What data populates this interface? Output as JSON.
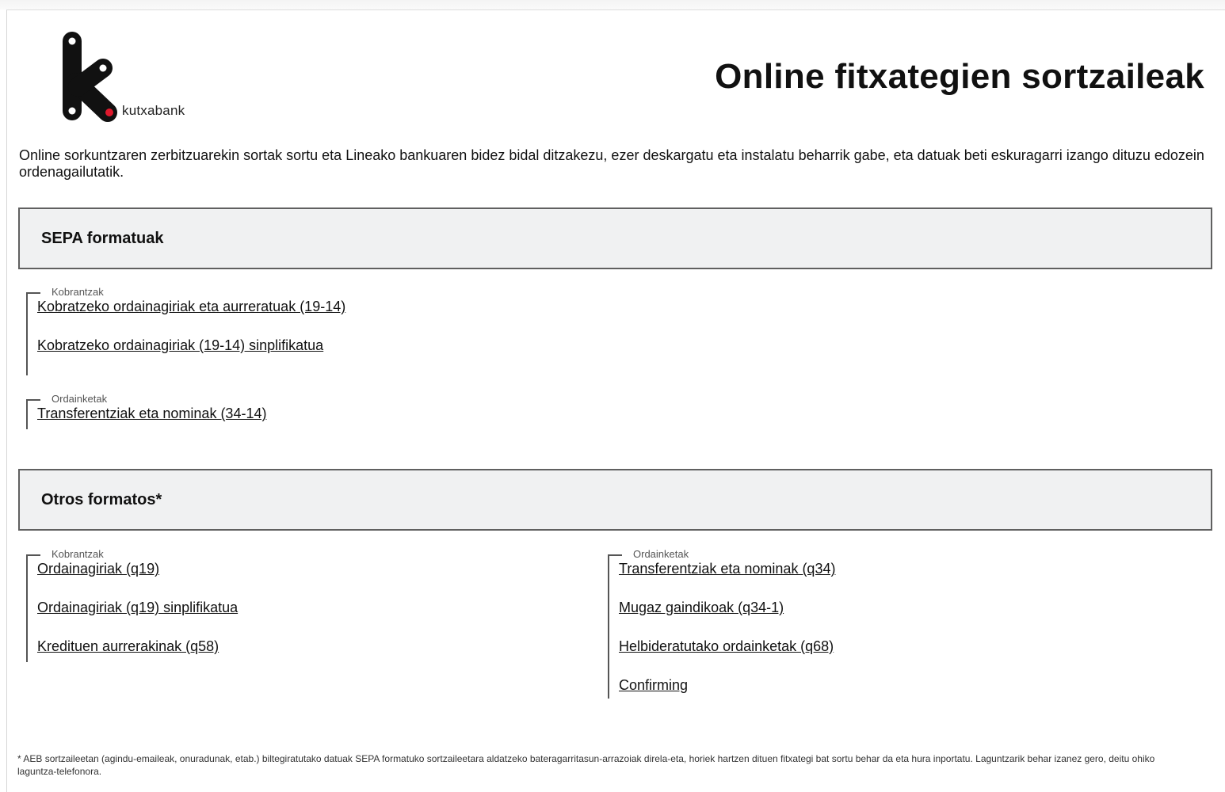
{
  "header": {
    "logo_text": "kutxabank",
    "title": "Online fitxategien sortzaileak"
  },
  "intro": "Online sorkuntzaren zerbitzuarekin sortak sortu eta Lineako bankuaren bidez bidal ditzakezu, ezer deskargatu eta instalatu beharrik gabe, eta datuak beti eskuragarri izango dituzu edozein ordenagailutatik.",
  "sections": {
    "sepa": {
      "title": "SEPA formatuak",
      "kobrantzak": {
        "legend": "Kobrantzak",
        "links": [
          "Kobratzeko ordainagiriak eta aurreratuak (19-14)",
          "Kobratzeko ordainagiriak (19-14) sinplifikatua"
        ]
      },
      "ordainketak": {
        "legend": "Ordainketak",
        "links": [
          "Transferentziak eta nominak (34-14)"
        ]
      }
    },
    "otros": {
      "title": "Otros formatos*",
      "kobrantzak": {
        "legend": "Kobrantzak",
        "links": [
          "Ordainagiriak (q19)",
          "Ordainagiriak (q19) sinplifikatua",
          "Kredituen aurrerakinak (q58)"
        ]
      },
      "ordainketak": {
        "legend": "Ordainketak",
        "links": [
          "Transferentziak eta nominak (q34)",
          "Mugaz gaindikoak (q34-1)",
          "Helbideratutako ordainketak (q68)",
          "Confirming"
        ]
      }
    }
  },
  "footnote": "* AEB sortzaileetan (agindu-emaileak, onuradunak, etab.) biltegiratutako datuak SEPA formatuko sortzaileetara aldatzeko bateragarritasun-arrazoiak direla-eta, horiek hartzen dituen fitxategi bat sortu behar da eta hura inportatu. Laguntzarik behar izanez gero, deitu ohiko laguntza-telefonora.",
  "colors": {
    "logo_black": "#111111",
    "logo_red": "#e0192d",
    "section_header_bg": "#f0f1f2",
    "section_header_border": "#606060"
  }
}
